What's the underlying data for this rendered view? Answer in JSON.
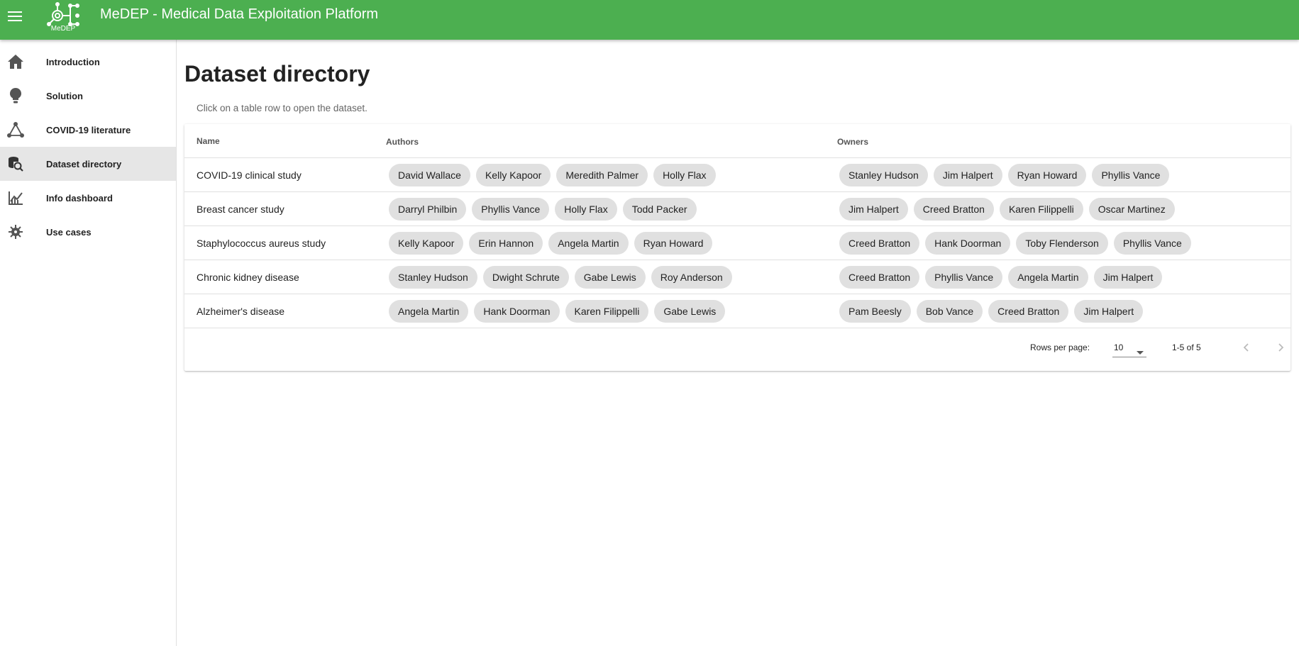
{
  "app": {
    "title": "MeDEP - Medical Data Exploitation Platform",
    "logo_text": "MeDEP",
    "brand_color": "#4caf50"
  },
  "sidebar": {
    "items": [
      {
        "label": "Introduction",
        "icon": "home-icon"
      },
      {
        "label": "Solution",
        "icon": "lightbulb-icon"
      },
      {
        "label": "COVID-19 literature",
        "icon": "graph-network-icon"
      },
      {
        "label": "Dataset directory",
        "icon": "database-search-icon",
        "active": true
      },
      {
        "label": "Info dashboard",
        "icon": "chart-line-icon"
      },
      {
        "label": "Use cases",
        "icon": "virus-icon"
      }
    ]
  },
  "page": {
    "title": "Dataset directory",
    "hint": "Click on a table row to open the dataset."
  },
  "table": {
    "columns": {
      "name": "Name",
      "authors": "Authors",
      "owners": "Owners"
    },
    "rows": [
      {
        "name": "COVID-19 clinical study",
        "authors": [
          "David Wallace",
          "Kelly Kapoor",
          "Meredith Palmer",
          "Holly Flax"
        ],
        "owners": [
          "Stanley Hudson",
          "Jim Halpert",
          "Ryan Howard",
          "Phyllis Vance"
        ]
      },
      {
        "name": "Breast cancer study",
        "authors": [
          "Darryl Philbin",
          "Phyllis Vance",
          "Holly Flax",
          "Todd Packer"
        ],
        "owners": [
          "Jim Halpert",
          "Creed Bratton",
          "Karen Filippelli",
          "Oscar Martinez"
        ]
      },
      {
        "name": "Staphylococcus aureus study",
        "authors": [
          "Kelly Kapoor",
          "Erin Hannon",
          "Angela Martin",
          "Ryan Howard"
        ],
        "owners": [
          "Creed Bratton",
          "Hank Doorman",
          "Toby Flenderson",
          "Phyllis Vance"
        ]
      },
      {
        "name": "Chronic kidney disease",
        "authors": [
          "Stanley Hudson",
          "Dwight Schrute",
          "Gabe Lewis",
          "Roy Anderson"
        ],
        "owners": [
          "Creed Bratton",
          "Phyllis Vance",
          "Angela Martin",
          "Jim Halpert"
        ]
      },
      {
        "name": "Alzheimer's disease",
        "authors": [
          "Angela Martin",
          "Hank Doorman",
          "Karen Filippelli",
          "Gabe Lewis"
        ],
        "owners": [
          "Pam Beesly",
          "Bob Vance",
          "Creed Bratton",
          "Jim Halpert"
        ]
      }
    ]
  },
  "pagination": {
    "rows_per_page_label": "Rows per page:",
    "rows_per_page": "10",
    "range": "1-5 of 5"
  }
}
